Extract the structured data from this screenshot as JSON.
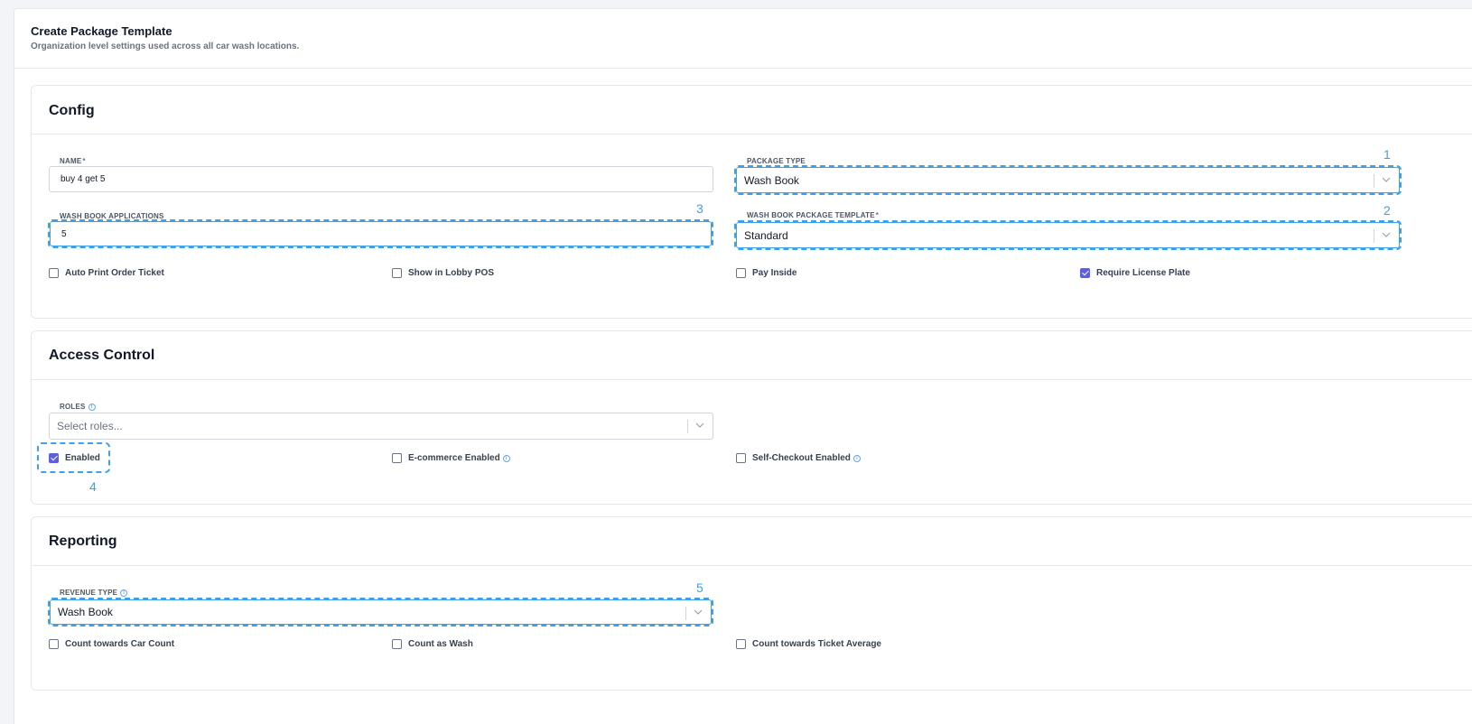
{
  "page": {
    "title": "Create Package Template",
    "subtitle": "Organization level settings used across all car wash locations."
  },
  "config": {
    "title": "Config",
    "name_label": "NAME",
    "name_value": "buy 4 get 5",
    "package_type_label": "PACKAGE TYPE",
    "package_type_value": "Wash Book",
    "wash_book_applications_label": "WASH BOOK APPLICATIONS",
    "wash_book_applications_value": "5",
    "wash_book_package_template_label": "WASH BOOK PACKAGE TEMPLATE",
    "wash_book_package_template_value": "Standard",
    "required_mark": "*",
    "checkboxes": [
      {
        "label": "Auto Print Order Ticket",
        "checked": false
      },
      {
        "label": "Show in Lobby POS",
        "checked": false
      },
      {
        "label": "Pay Inside",
        "checked": false
      },
      {
        "label": "Require License Plate",
        "checked": true
      }
    ]
  },
  "access_control": {
    "title": "Access Control",
    "roles_label": "ROLES",
    "roles_placeholder": "Select roles...",
    "info_glyph": "i",
    "checkboxes": [
      {
        "label": "Enabled",
        "checked": true
      },
      {
        "label": "E-commerce Enabled",
        "checked": false
      },
      {
        "label": "Self-Checkout Enabled",
        "checked": false
      }
    ]
  },
  "reporting": {
    "title": "Reporting",
    "revenue_type_label": "REVENUE TYPE",
    "revenue_type_value": "Wash Book",
    "checkboxes": [
      {
        "label": "Count towards Car Count",
        "checked": false
      },
      {
        "label": "Count as Wash",
        "checked": false
      },
      {
        "label": "Count towards Ticket Average",
        "checked": false
      }
    ]
  },
  "markers": [
    "1",
    "2",
    "3",
    "4",
    "5"
  ],
  "colors": {
    "accent": "#5b5fe0",
    "highlight": "#3ea0e8",
    "border": "#e5e7eb"
  },
  "icons": {
    "select_chevron": "chevron-down-icon",
    "info": "info-icon",
    "checkmark": "check-icon"
  }
}
